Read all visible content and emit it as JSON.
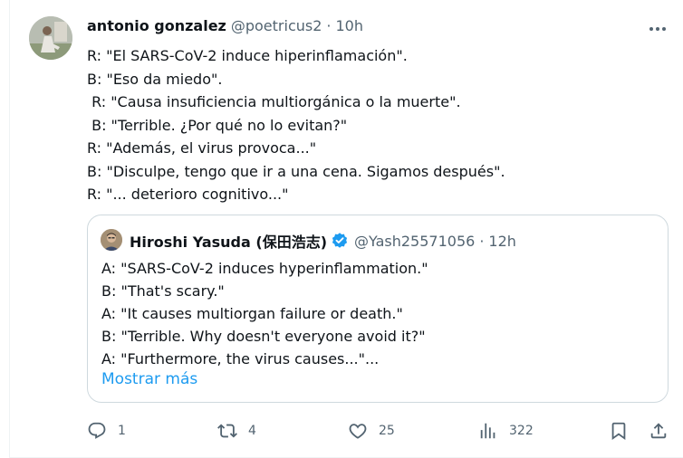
{
  "post": {
    "display_name": "antonio gonzalez",
    "handle": "@poetricus2",
    "separator": "·",
    "time": "10h",
    "text_lines": [
      "R: \"El SARS-CoV-2 induce hiperinflamación\".",
      "B: \"Eso da miedo\".",
      " R: \"Causa insuficiencia multiorgánica o la muerte\".",
      " B: \"Terrible. ¿Por qué no lo evitan?\"",
      "R: \"Además, el virus provoca...\"",
      "B: \"Disculpe, tengo que ir a una cena. Sigamos después\".",
      "R: \"... deterioro cognitivo...\""
    ]
  },
  "quote": {
    "display_name": "Hiroshi Yasuda (保田浩志)",
    "handle": "@Yash25571056",
    "separator": "·",
    "time": "12h",
    "text_lines": [
      "A: \"SARS-CoV-2 induces hyperinflammation.\"",
      "B: \"That's scary.\"",
      "A: \"It causes multiorgan failure or death.\"",
      "B: \"Terrible. Why doesn't everyone avoid it?\"",
      "A: \"Furthermore, the virus causes...\"..."
    ],
    "show_more": "Mostrar más"
  },
  "actions": {
    "replies": "1",
    "reposts": "4",
    "likes": "25",
    "views": "322"
  },
  "icons": {
    "more": "more-horizontal-icon",
    "verified": "verified-badge-icon",
    "reply": "reply-icon",
    "repost": "repost-icon",
    "like": "heart-icon",
    "views": "views-chart-icon",
    "bookmark": "bookmark-icon",
    "share": "share-icon"
  },
  "colors": {
    "text": "#0f1419",
    "secondary": "#536471",
    "link": "#1d9bf0",
    "border": "#cfd9de"
  }
}
